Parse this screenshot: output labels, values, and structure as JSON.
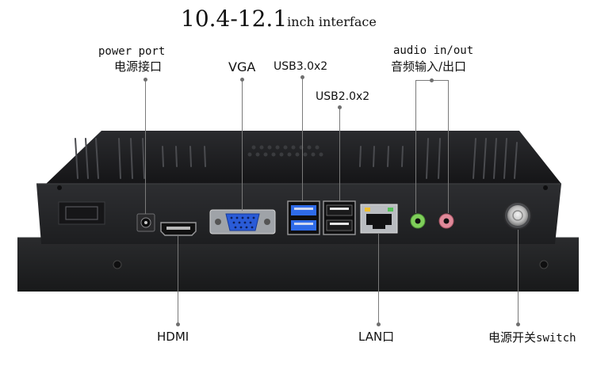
{
  "title": {
    "size": "10.4-12.1",
    "suffix": "inch interface"
  },
  "labels": {
    "power_en": "power port",
    "power_cn": "电源接口",
    "vga": "VGA",
    "usb3": "USB3.0x2",
    "usb2": "USB2.0x2",
    "audio_en": "audio in/out",
    "audio_cn": "音频输入/出口",
    "hdmi": "HDMI",
    "lan": "LAN口",
    "switch_cn": "电源开关",
    "switch_en": "switch"
  },
  "colors": {
    "chassis": "#1b1b1d",
    "back_panel": "#26272a",
    "front_bezel": "#202123",
    "vga_port": "#2a5bd7",
    "usb3_port": "#2f6be8",
    "audio_in": "#7fcf5a",
    "audio_out": "#e08a9a",
    "leader_line": "#7a7a7a"
  }
}
